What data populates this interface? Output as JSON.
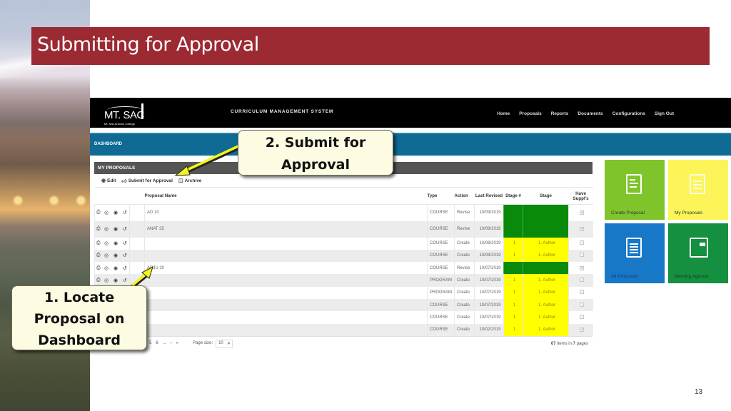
{
  "slide": {
    "title": "Submitting for Approval",
    "page_number": "13"
  },
  "app": {
    "logo_text": "MT. SAC",
    "logo_subtext": "Mt. San Antonio College",
    "system_title": "CURRICULUM MANAGEMENT SYSTEM",
    "nav": [
      "Home",
      "Proposals",
      "Reports",
      "Documents",
      "Configurations",
      "Sign Out"
    ],
    "dashboard_label": "DASHBOARD"
  },
  "panel": {
    "title": "MY PROPOSALS",
    "toolbar": {
      "edit": "Edit",
      "submit": "Submit for Approval",
      "archive": "Archive"
    },
    "columns": {
      "name": "Proposal Name",
      "type": "Type",
      "action": "Action",
      "last_revised": "Last Revised",
      "stage_num": "Stage #",
      "stage": "Stage",
      "suppl": "Have Suppl's"
    },
    "rows": [
      {
        "name": "AD 10",
        "type": "COURSE",
        "action": "Revise",
        "date": "10/09/2019",
        "stage_num": "",
        "stage": "",
        "stage_color": "green",
        "suppl": true
      },
      {
        "name": "ANAT 35",
        "type": "COURSE",
        "action": "Revise",
        "date": "10/09/2019",
        "stage_num": "",
        "stage": "",
        "stage_color": "green",
        "suppl": true
      },
      {
        "name": "",
        "type": "COURSE",
        "action": "Create",
        "date": "10/08/2019",
        "stage_num": "1",
        "stage": "1. Author",
        "stage_color": "yellow",
        "suppl": false
      },
      {
        "name": "",
        "type": "COURSE",
        "action": "Create",
        "date": "10/08/2019",
        "stage_num": "1",
        "stage": "1. Author",
        "stage_color": "yellow",
        "suppl": false
      },
      {
        "name": "ADJU 20",
        "type": "COURSE",
        "action": "Revise",
        "date": "10/07/2019",
        "stage_num": "",
        "stage": "",
        "stage_color": "green",
        "suppl": true
      },
      {
        "name": "",
        "type": "PROGRAM",
        "action": "Create",
        "date": "10/07/2019",
        "stage_num": "1",
        "stage": "1. Author",
        "stage_color": "yellow",
        "suppl": false
      },
      {
        "name": "",
        "type": "PROGRAM",
        "action": "Create",
        "date": "10/07/2019",
        "stage_num": "1",
        "stage": "1. Author",
        "stage_color": "yellow",
        "suppl": false
      },
      {
        "name": "",
        "type": "COURSE",
        "action": "Create",
        "date": "10/07/2019",
        "stage_num": "1",
        "stage": "1. Author",
        "stage_color": "yellow",
        "suppl": false
      },
      {
        "name": "",
        "type": "COURSE",
        "action": "Create",
        "date": "10/07/2019",
        "stage_num": "1",
        "stage": "1. Author",
        "stage_color": "yellow",
        "suppl": false
      },
      {
        "name": "",
        "type": "COURSE",
        "action": "Create",
        "date": "10/02/2019",
        "stage_num": "1",
        "stage": "1. Author",
        "stage_color": "yellow",
        "suppl": true
      }
    ],
    "pager": {
      "pages": [
        "5",
        "6",
        "..."
      ],
      "next": "›",
      "last": "»",
      "page_size_label": "Page size:",
      "page_size": "10",
      "items_count": "67",
      "items_mid": "items in",
      "pages_count": "7",
      "pages_label": "pages"
    }
  },
  "tiles": [
    {
      "label": "Create Proposal",
      "icon": "form-edit-icon",
      "color": "#80c42c"
    },
    {
      "label": "My Proposals",
      "icon": "clipboard-icon",
      "color": "#fbf55a"
    },
    {
      "label": "All Proposals",
      "icon": "clipboard-list-icon",
      "color": "#1878c8"
    },
    {
      "label": "Meeting Agenda",
      "icon": "notebook-icon",
      "color": "#149040"
    }
  ],
  "callouts": {
    "step1": [
      "1. Locate",
      "Proposal on",
      "Dashboard"
    ],
    "step2": [
      "2. Submit for",
      "Approval"
    ]
  },
  "colors": {
    "title_bar": "#9b2a33",
    "dashboard_bar": "#0f6a94",
    "stage_green": "#0a8a0a",
    "stage_yellow": "#ffff00",
    "arrow": "#f5f51a"
  }
}
